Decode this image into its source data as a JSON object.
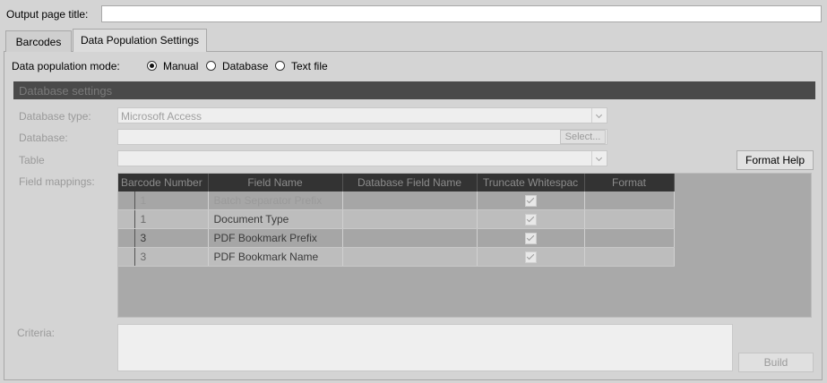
{
  "output_page_title": {
    "label": "Output page title:",
    "value": ""
  },
  "tabs": [
    {
      "label": "Barcodes",
      "active": false
    },
    {
      "label": "Data Population Settings",
      "active": true
    }
  ],
  "mode": {
    "label": "Data population mode:",
    "options": [
      {
        "label": "Manual",
        "selected": true
      },
      {
        "label": "Database",
        "selected": false
      },
      {
        "label": "Text file",
        "selected": false
      }
    ]
  },
  "db_settings": {
    "header": "Database settings",
    "database_type_label": "Database type:",
    "database_type_value": "Microsoft Access",
    "database_label": "Database:",
    "database_value": "",
    "select_button": "Select...",
    "table_label": "Table",
    "table_value": "",
    "format_help_button": "Format Help",
    "field_mappings_label": "Field mappings:",
    "criteria_label": "Criteria:",
    "criteria_value": "",
    "build_button": "Build"
  },
  "grid": {
    "columns": [
      "Barcode Number",
      "Field Name",
      "Database Field Name",
      "Truncate Whitespac",
      "Format"
    ],
    "rows": [
      {
        "barcode": "1",
        "field": "Batch Separator Prefix",
        "db_field": "",
        "truncate": true,
        "format": ""
      },
      {
        "barcode": "1",
        "field": "Document Type",
        "db_field": "",
        "truncate": true,
        "format": ""
      },
      {
        "barcode": "3",
        "field": "PDF Bookmark Prefix",
        "db_field": "",
        "truncate": true,
        "format": ""
      },
      {
        "barcode": "3",
        "field": "PDF Bookmark Name",
        "db_field": "",
        "truncate": true,
        "format": ""
      }
    ]
  },
  "colors": {
    "background": "#d4d4d4",
    "header_bar": "#4a4a4a",
    "grid_header": "#333333"
  }
}
